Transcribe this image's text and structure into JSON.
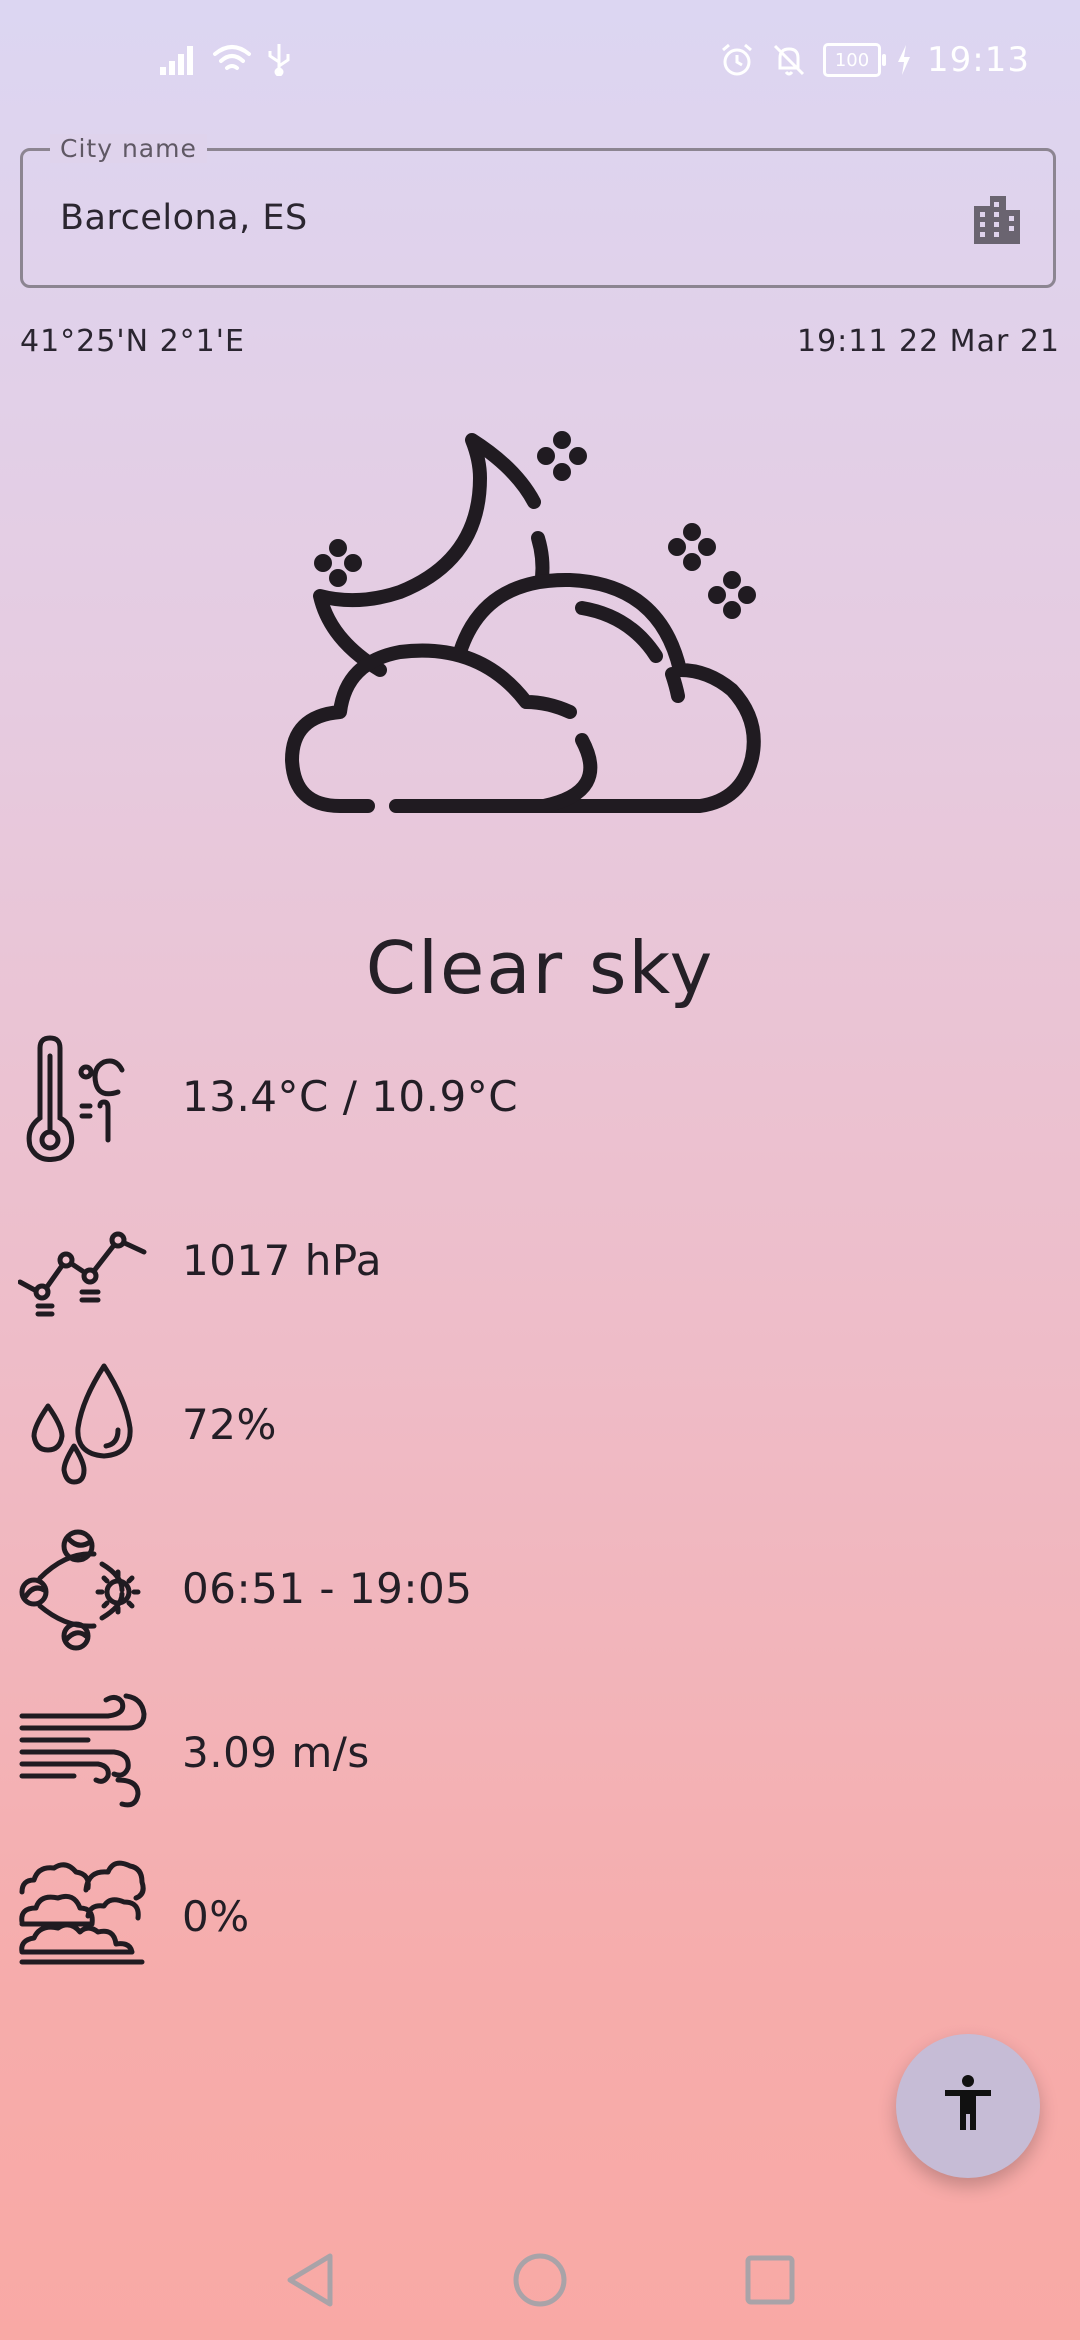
{
  "status_bar": {
    "time": "19:13",
    "battery": "100",
    "icons": [
      "signal-icon",
      "wifi-icon",
      "usb-icon",
      "alarm-icon",
      "bell-off-icon",
      "battery-icon",
      "charging-icon"
    ]
  },
  "city_field": {
    "label": "City name",
    "value": "Barcelona, ES",
    "icon": "city-icon"
  },
  "location": {
    "coords": "41°25'N 2°1'E",
    "datetime": "19:11 22 Mar 21"
  },
  "weather": {
    "icon": "moon-cloud-stars-icon",
    "summary": "Clear sky",
    "details": [
      {
        "icon": "thermometer-icon",
        "value": "13.4°C / 10.9°C"
      },
      {
        "icon": "pressure-icon",
        "value": "1017 hPa"
      },
      {
        "icon": "humidity-icon",
        "value": "72%"
      },
      {
        "icon": "sunrise-sunset-icon",
        "value": "06:51 - 19:05"
      },
      {
        "icon": "wind-icon",
        "value": "3.09 m/s"
      },
      {
        "icon": "clouds-icon",
        "value": "0%"
      }
    ]
  },
  "fab": {
    "icon": "accessibility-icon"
  },
  "nav_bar": {
    "icons": [
      "back-icon",
      "home-icon",
      "recents-icon"
    ]
  },
  "colors": {
    "bg_top": "#dcd6f2",
    "bg_bottom": "#f9a9a5",
    "fab": "#c6bcd6",
    "text": "#231e26"
  }
}
